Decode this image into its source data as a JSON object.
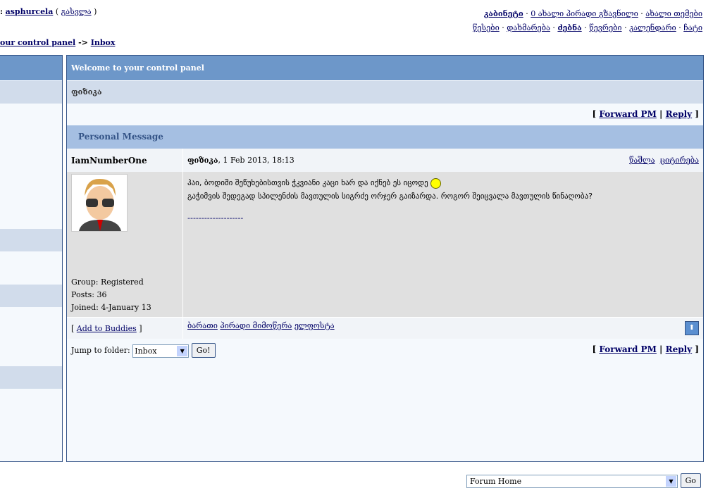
{
  "userbar": {
    "prefix": ":",
    "username": "asphurcela",
    "logout": "გასვლა"
  },
  "topnav": {
    "row1": [
      "კაბინეტი",
      "0 ახალი პირადი გზავნილი",
      "ახალი თემები"
    ],
    "row2": [
      "წესები",
      "დახმარება",
      "ძებნა",
      "წევრები",
      "კალენდარი",
      "ჩატი"
    ]
  },
  "breadcrumb": {
    "control_panel": "our control panel",
    "sep": "->",
    "inbox": "Inbox"
  },
  "main": {
    "header": "Welcome to your control panel",
    "subheader": "ფიზიკა",
    "forward": "Forward PM",
    "reply": "Reply",
    "pm_title": "Personal Message"
  },
  "message": {
    "author": "IamNumberOne",
    "subject": "ფიზიკა",
    "date": ", 1 Feb 2013, 18:13",
    "delete": "წაშლა",
    "quote": "ციტირება",
    "line1": "ჰაი, ბოდიში შეწუხებისთვის ჭკვიანი კაცი ხარ და იქნებ ეს იცოდე",
    "line2": "გაჭიმვის შედეგად სპილენძის მავთულის სიგრძე ორჯერ გაიზარდა. როგორ შეიცვალა მავთულის წინაღობა?",
    "sig": "--------------------",
    "group": "Group: Registered",
    "posts": "Posts: 36",
    "joined": "Joined: 4-January 13",
    "add_buddies": "Add to Buddies",
    "links": [
      "ბარათი",
      "პირადი მიმოწერა",
      "ელფოსტა"
    ]
  },
  "folder": {
    "label": "Jump to folder:",
    "value": "Inbox",
    "go": "Go!"
  },
  "footer": {
    "forum_select": "Forum Home",
    "go": "Go"
  }
}
